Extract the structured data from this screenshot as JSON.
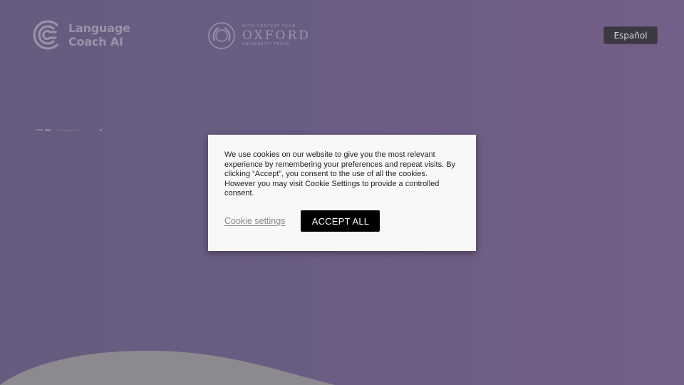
{
  "header": {
    "logo": {
      "line1": "Language",
      "line2": "Coach AI",
      "icon": "language-coach-c-icon"
    },
    "partner": {
      "small": "with content from",
      "big": "OXFORD",
      "sub": "UNIVERSITY PRESS",
      "icon": "oxford-laurel-icon"
    },
    "language_button": "Español"
  },
  "cookie_dialog": {
    "message": "We use cookies on our website to give you the most relevant experience by remembering your preferences and repeat visits. By clicking “Accept”, you consent to the use of all the cookies. However you may visit Cookie Settings to provide a controlled consent.",
    "settings_label": "Cookie settings",
    "accept_label": "ACCEPT ALL"
  },
  "colors": {
    "background": "#6b5d84",
    "dialog": "#f8f8f8",
    "accept_button": "#000000",
    "language_button": "#3b3843"
  }
}
